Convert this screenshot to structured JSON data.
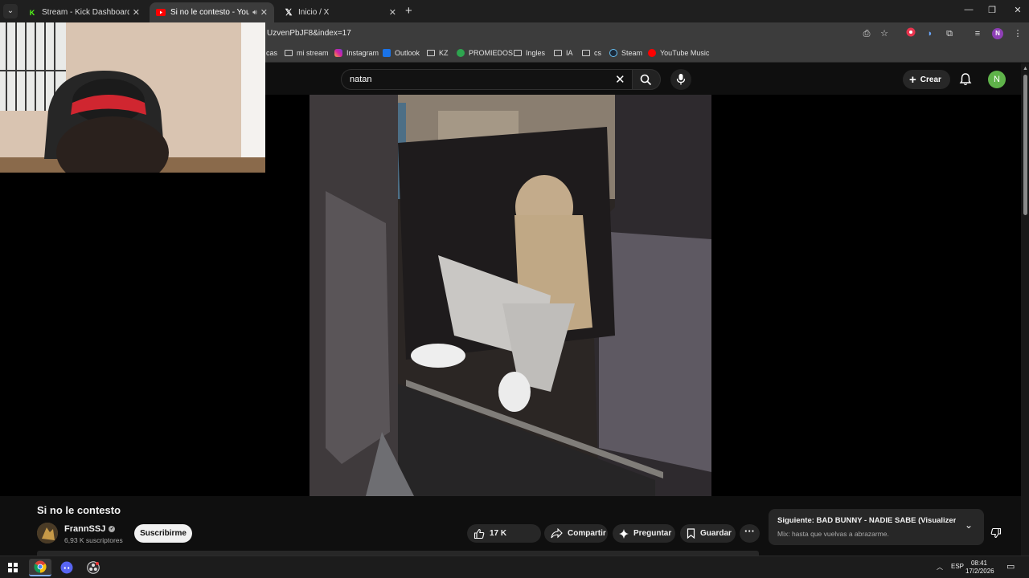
{
  "browser": {
    "tabs": [
      {
        "title": "Stream - Kick Dashboard",
        "favicon": "kick-icon",
        "active": false
      },
      {
        "title": "Si no le contesto - YouTube",
        "favicon": "youtube-icon",
        "active": true
      },
      {
        "title": "Inicio / X",
        "favicon": "x-icon",
        "active": false
      }
    ],
    "url": "UzvenPbJF8&index=17",
    "profile_initial": "N",
    "bookmarks": [
      {
        "label": "cas",
        "icon": "none"
      },
      {
        "label": "mi stream",
        "icon": "folder-icon"
      },
      {
        "label": "Instagram",
        "icon": "instagram-icon"
      },
      {
        "label": "Outlook",
        "icon": "outlook-icon"
      },
      {
        "label": "KZ",
        "icon": "folder-icon"
      },
      {
        "label": "PROMIEDOS",
        "icon": "promiedos-icon"
      },
      {
        "label": "Ingles",
        "icon": "folder-icon"
      },
      {
        "label": "IA",
        "icon": "folder-icon"
      },
      {
        "label": "cs",
        "icon": "folder-icon"
      },
      {
        "label": "Steam",
        "icon": "steam-icon"
      },
      {
        "label": "YouTube Music",
        "icon": "youtube-music-icon"
      }
    ]
  },
  "youtube": {
    "search_value": "natan",
    "create_label": "Crear",
    "avatar_initial": "N",
    "video": {
      "title": "Si no le contesto",
      "channel": "FrannSSJ",
      "subscribers": "6,93 K suscriptores",
      "subscribe_label": "Suscribirme",
      "likes": "17 K",
      "share_label": "Compartir",
      "ask_label": "Preguntar",
      "save_label": "Guardar"
    },
    "up_next": {
      "prefix": "Siguiente:",
      "title": " BAD BUNNY - NADIE SABE (Visualizer) | ...",
      "subtitle": "Mix: hasta que vuelvas a abrazarme."
    }
  },
  "taskbar": {
    "language": "ESP",
    "time": "08:41",
    "date": "17/2/2026"
  },
  "colors": {
    "accent_youtube": "#ff0000",
    "kick_green": "#53fc18",
    "avatar_green": "#5fb34a",
    "profile_purple": "#8e3fb5"
  }
}
